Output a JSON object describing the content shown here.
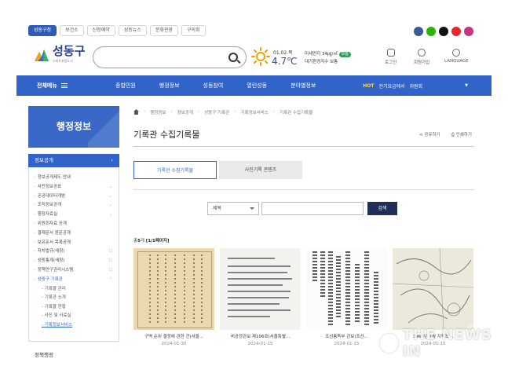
{
  "top_tabs": [
    "성동구청",
    "보건소",
    "신청예약",
    "성동뉴스",
    "문화관광",
    "구의회"
  ],
  "sns": [
    {
      "name": "facebook-icon",
      "color": "#3b5998"
    },
    {
      "name": "blog-icon",
      "color": "#2db400"
    },
    {
      "name": "x-icon",
      "color": "#111111"
    },
    {
      "name": "youtube-icon",
      "color": "#e8262d"
    },
    {
      "name": "instagram-icon",
      "color": "#c13584"
    }
  ],
  "header": {
    "logo_text": "성동구",
    "logo_sub": "스마트포용도시",
    "search_placeholder": "",
    "weather_date": "01.02.목",
    "weather_temp": "4.7℃",
    "air_line1": "미세먼지 34㎍/㎥",
    "air_badge": "보통",
    "air_line2": "대기환경지수 보통",
    "util": [
      "로그인",
      "회원가입",
      "LANGUAGE"
    ]
  },
  "nav": {
    "all_menu": "전체메뉴",
    "items": [
      "종합민원",
      "행정정보",
      "성동참여",
      "열린성동",
      "분야별정보"
    ],
    "hot_label": "HOT",
    "hot_text": "전기요금에서",
    "hot_badge": "위원회"
  },
  "sidebar": {
    "title": "행정정보",
    "section": "정보공개",
    "items": [
      {
        "label": "정보공개제도 안내",
        "tail": ""
      },
      {
        "label": "사전정보공표",
        "tail": "⌄"
      },
      {
        "label": "공공데이터개방",
        "tail": "⌄"
      },
      {
        "label": "조직정보공개",
        "tail": "⌄"
      },
      {
        "label": "행정자료실",
        "tail": "⌄"
      },
      {
        "label": "위원회자료 공개",
        "tail": ""
      },
      {
        "label": "결재문서 원문공개",
        "tail": ""
      },
      {
        "label": "보유문서 목록공개",
        "tail": ""
      },
      {
        "label": "자치법규(새창)",
        "tail": "☐"
      },
      {
        "label": "성동통계(새창)",
        "tail": "☐"
      },
      {
        "label": "정책연구관리시스템",
        "tail": "☐"
      },
      {
        "label": "성동구 기록관",
        "tail": "⌃"
      }
    ],
    "sub_items": [
      "기록물 관리",
      "기록관 소개",
      "기록물 현황",
      "사진 및 사료실",
      "기록정보서비스"
    ],
    "next_section": "정책행정"
  },
  "main": {
    "breadcrumb": [
      "행정정보",
      "정보공개",
      "성동구 기록관",
      "기록정보서비스",
      "기록관 수집기록물"
    ],
    "title": "기록관 수집기록물",
    "tools": [
      "공유하기",
      "인쇄하기"
    ],
    "tabs": [
      "기록관 수집기록물",
      "사진기록 콘텐츠"
    ],
    "filter_value": "제목",
    "search_button": "검색",
    "count_prefix": "총",
    "count_value": "5",
    "count_suffix": "개",
    "page_info": "[1/1페이지]"
  },
  "cards": [
    {
      "title": "구역 순위 결정에 관한 건(서울...",
      "date": "2024-01-30"
    },
    {
      "title": "비공정관보 제106호(서울특별...",
      "date": "2024-01-15"
    },
    {
      "title": "조선총독부 관보(조선...",
      "date": "2024-01-15"
    },
    {
      "title": "1968년 1월 지적도...",
      "date": "2024-01-15"
    }
  ],
  "watermark": {
    "text": "THE NEWS IN",
    "small": "더뉴스인"
  }
}
